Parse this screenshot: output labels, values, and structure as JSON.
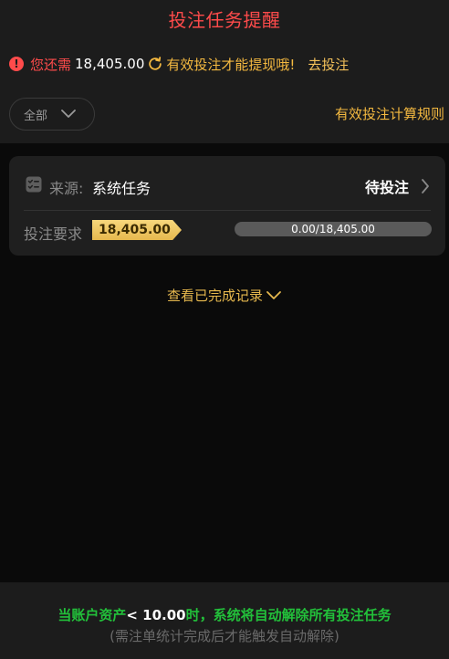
{
  "header": {
    "title": "投注任务提醒"
  },
  "notice": {
    "prefix": "您还需",
    "amount": "18,405.00",
    "message": "有效投注才能提现哦!",
    "action_label": "去投注"
  },
  "filter": {
    "selected": "全部"
  },
  "rules_link_label": "有效投注计算规则",
  "task": {
    "source_label": "来源:",
    "source_value": "系统任务",
    "status": "待投注",
    "requirement_label": "投注要求",
    "requirement_amount": "18,405.00",
    "progress_text": "0.00/18,405.00",
    "progress_fraction": 0
  },
  "history_link_label": "查看已完成记录",
  "footer": {
    "line1_a": "当账户资产",
    "line1_b": "< 10.00",
    "line1_c": "时，系统将自动解除所有投注任务",
    "line2": "(需注单统计完成后才能触发自动解除)"
  },
  "colors": {
    "accent_red": "#ff4b4b",
    "accent_gold": "#f4b940",
    "accent_green": "#22c03a"
  },
  "icons": [
    "alert-icon",
    "refresh-icon",
    "chevron-down-icon",
    "checklist-icon",
    "chevron-right-icon"
  ]
}
